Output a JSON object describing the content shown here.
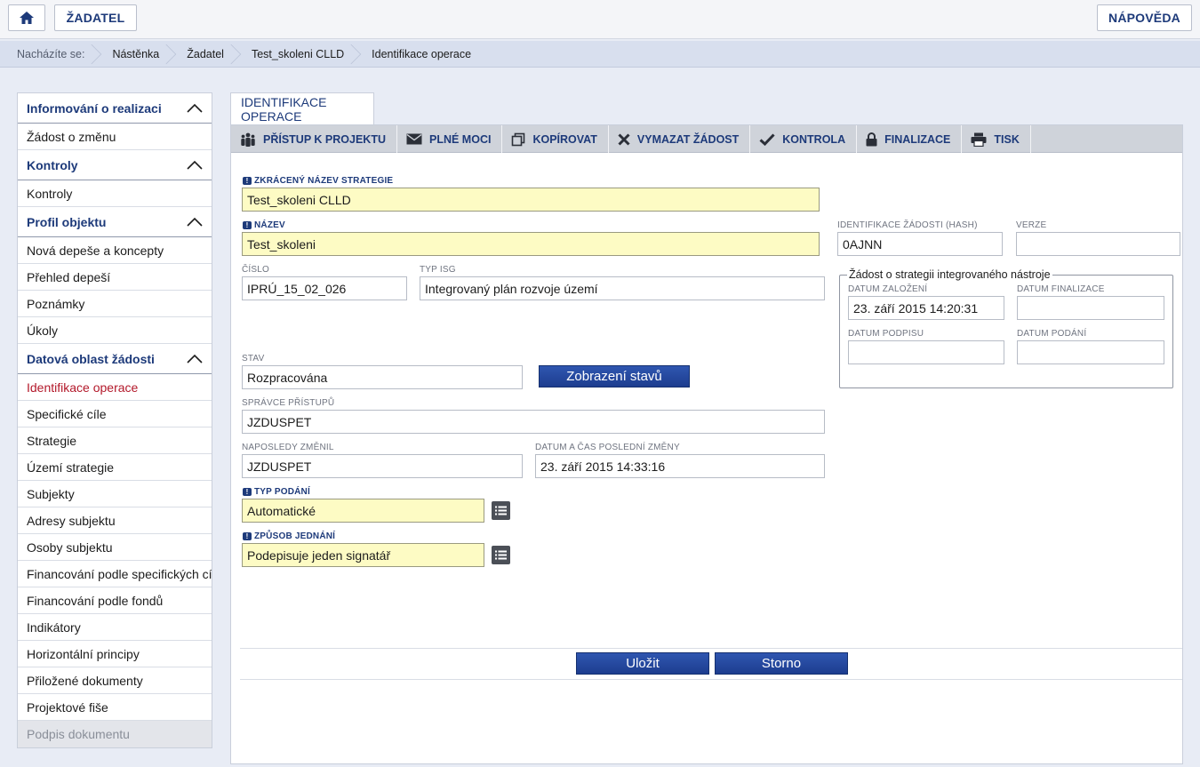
{
  "topbar": {
    "zadatel_label": "ŽADATEL",
    "napoveda_label": "NÁPOVĚDA"
  },
  "breadcrumb": {
    "prefix": "Nacházíte se:",
    "items": [
      "Nástěnka",
      "Žadatel",
      "Test_skoleni CLLD",
      "Identifikace operace"
    ]
  },
  "sidebar": {
    "sections": [
      {
        "title": "Informování o realizaci",
        "items": [
          "Žádost o změnu"
        ]
      },
      {
        "title": "Kontroly",
        "items": [
          "Kontroly"
        ]
      },
      {
        "title": "Profil objektu",
        "items": [
          "Nová depeše a koncepty",
          "Přehled depeší",
          "Poznámky",
          "Úkoly"
        ]
      },
      {
        "title": "Datová oblast žádosti",
        "items": [
          "Identifikace operace",
          "Specifické cíle",
          "Strategie",
          "Území strategie",
          "Subjekty",
          "Adresy subjektu",
          "Osoby subjektu",
          "Financování podle specifických cílů",
          "Financování podle fondů",
          "Indikátory",
          "Horizontální principy",
          "Přiložené dokumenty",
          "Projektové fiše",
          "Podpis dokumentu"
        ]
      }
    ]
  },
  "main": {
    "tab_label": "Identifikace operace",
    "toolbar": {
      "access": "PŘÍSTUP K PROJEKTU",
      "powers": "PLNÉ MOCI",
      "copy": "KOPÍROVAT",
      "delete": "VYMAZAT ŽÁDOST",
      "check": "KONTROLA",
      "finalize": "FINALIZACE",
      "print": "TISK"
    },
    "form": {
      "short_name_label": "Zkrácený název strategie",
      "short_name_value": "Test_skoleni CLLD",
      "name_label": "Název",
      "name_value": "Test_skoleni",
      "hash_label": "Identifikace žádosti (hash)",
      "hash_value": "0AJNN",
      "version_label": "Verze",
      "version_value": "",
      "number_label": "Číslo",
      "number_value": "IPRÚ_15_02_026",
      "isg_type_label": "Typ ISG",
      "isg_type_value": "Integrovaný plán rozvoje území",
      "state_label": "Stav",
      "state_value": "Rozpracována",
      "show_states_button": "Zobrazení stavů",
      "access_admin_label": "Správce přístupů",
      "access_admin_value": "JZDUSPET",
      "last_changed_by_label": "Naposledy změnil",
      "last_changed_by_value": "JZDUSPET",
      "last_change_label": "Datum a čas poslední změny",
      "last_change_value": "23. září 2015 14:33:16",
      "submission_type_label": "Typ podání",
      "submission_type_value": "Automatické",
      "signing_label": "Způsob jednání",
      "signing_value": "Podepisuje jeden signatář",
      "fieldset_legend": "Žádost o strategii integrovaného nástroje",
      "created_label": "Datum založení",
      "created_value": "23. září 2015 14:20:31",
      "finalized_label": "Datum finalizace",
      "finalized_value": "",
      "signed_label": "Datum podpisu",
      "signed_value": "",
      "submitted_label": "Datum podání",
      "submitted_value": ""
    },
    "save_button": "Uložit",
    "cancel_button": "Storno"
  },
  "colors": {
    "accent_blue": "#1d3a7a",
    "required_yellow": "#fdfbc4",
    "active_red": "#b3182a"
  }
}
